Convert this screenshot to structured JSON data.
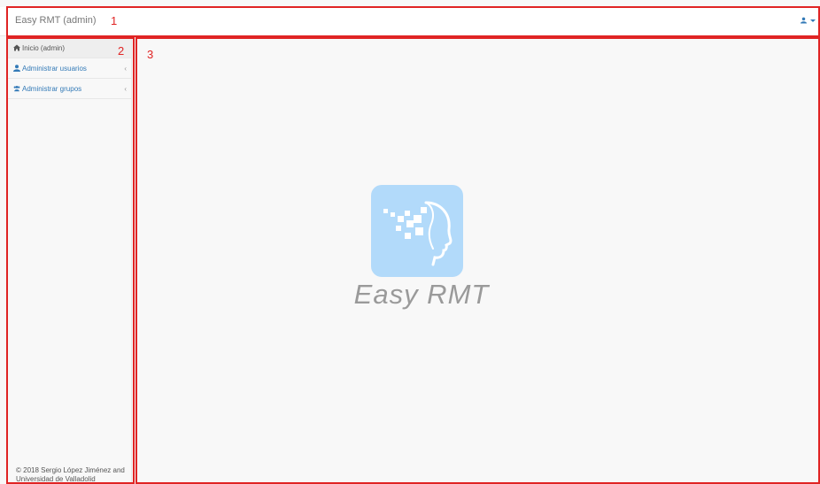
{
  "navbar": {
    "brand": "Easy RMT (admin)",
    "user_icon": "user-icon"
  },
  "sidebar": {
    "items": [
      {
        "label": "Inicio (admin)",
        "icon": "home-icon",
        "active": true
      },
      {
        "label": "Administrar usuarios",
        "icon": "user-icon",
        "chevron": "‹"
      },
      {
        "label": "Administrar grupos",
        "icon": "users-icon",
        "chevron": "‹"
      }
    ],
    "footer_line1": "© 2018 Sergio López Jiménez and",
    "footer_line2": "Universidad de Valladolid"
  },
  "main": {
    "logo_text": "Easy RMT"
  },
  "annotations": {
    "n1": "1",
    "n2": "2",
    "n3": "3"
  },
  "colors": {
    "accent": "#337ab7",
    "annotation": "#e02424",
    "logo_bg": "#b2dafa"
  }
}
